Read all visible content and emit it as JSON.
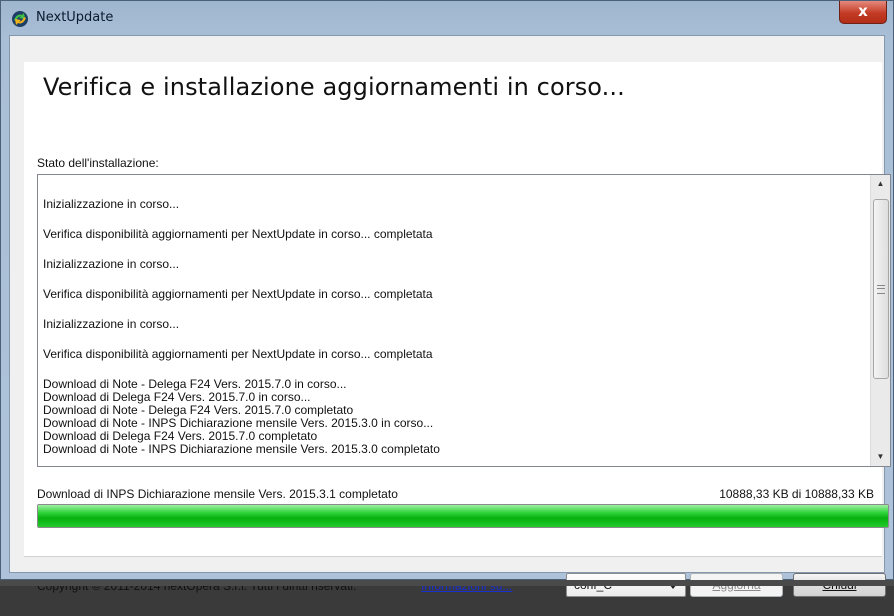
{
  "window": {
    "title": "NextUpdate",
    "close_label": "x",
    "icon": "nextupdate-app-icon"
  },
  "header": {
    "heading": "Verifica e installazione aggiornamenti in corso..."
  },
  "install": {
    "status_label": "Stato dell'installazione:",
    "log": [
      "",
      "Inizializzazione in corso...",
      "",
      "Verifica disponibilità aggiornamenti per NextUpdate in corso... completata",
      "",
      "Inizializzazione in corso...",
      "",
      "Verifica disponibilità aggiornamenti per NextUpdate in corso... completata",
      "",
      "Inizializzazione in corso...",
      "",
      "Verifica disponibilità aggiornamenti per NextUpdate in corso... completata",
      "",
      "Download di Note - Delega F24 Vers. 2015.7.0 in corso...",
      "Download di Delega F24 Vers. 2015.7.0 in corso...",
      "Download di Note - Delega F24 Vers. 2015.7.0 completato",
      "Download di Note - INPS Dichiarazione mensile Vers. 2015.3.0 in corso...",
      "Download di Delega F24 Vers. 2015.7.0 completato",
      "Download di Note - INPS Dichiarazione mensile Vers. 2015.3.0 completato"
    ]
  },
  "progress": {
    "label": "Download di INPS Dichiarazione mensile Vers. 2015.3.1 completato",
    "size_text": "10888,33 KB di 10888,33 KB",
    "percent": 100,
    "color": "#06b00f"
  },
  "footer": {
    "copyright": "Copyright © 2011-2014 nextOpera S.r.l. Tutti i diritti riservati.",
    "info_link": "Informazioni su...",
    "config_value": "conf_C",
    "update_button": "Aggiorna",
    "close_button": "Chiudi"
  }
}
